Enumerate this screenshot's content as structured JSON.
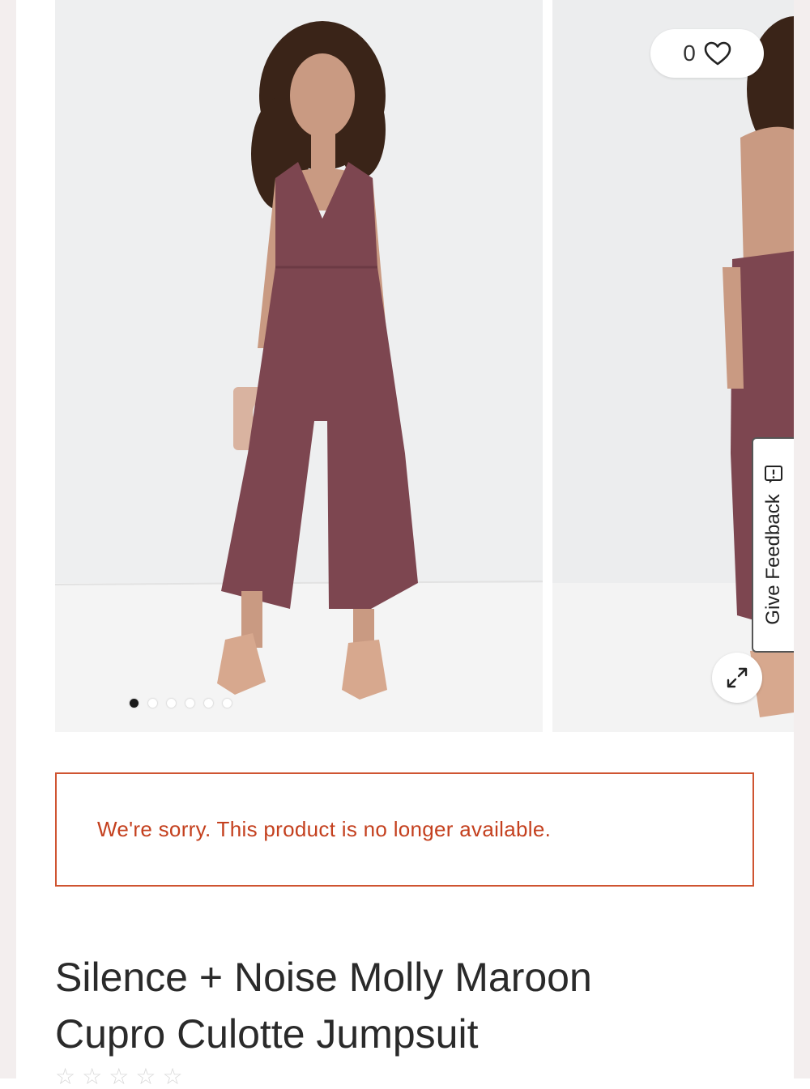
{
  "favorites": {
    "count": "0"
  },
  "carousel": {
    "slide_count": 6,
    "active_index": 0
  },
  "feedback": {
    "label": "Give Feedback"
  },
  "notice": {
    "message": "We're sorry. This product is no longer available."
  },
  "product": {
    "title_line1": "Silence + Noise Molly Maroon",
    "title_line2": "Cupro Culotte Jumpsuit"
  },
  "rating": {
    "stars": [
      "☆",
      "☆",
      "☆",
      "☆",
      "☆"
    ]
  },
  "colors": {
    "alert": "#c4401e",
    "alert_border": "#cf5431",
    "garment": "#7d4650",
    "photo_background": "#eeeff0"
  },
  "icons": {
    "favorite": "heart-icon",
    "expand": "expand-icon",
    "feedback": "feedback-icon",
    "rating": "star-icon"
  }
}
